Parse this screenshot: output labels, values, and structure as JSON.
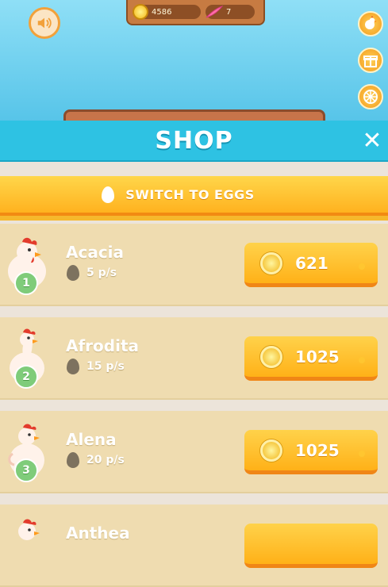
{
  "hud": {
    "coins": "4586",
    "feathers": "7"
  },
  "header": {
    "title": "SHOP"
  },
  "switch": {
    "label": "SWITCH TO EGGS"
  },
  "items": [
    {
      "level": "1",
      "name": "Acacia",
      "rate": "5 p/s",
      "price": "621"
    },
    {
      "level": "2",
      "name": "Afrodita",
      "rate": "15 p/s",
      "price": "1025"
    },
    {
      "level": "3",
      "name": "Alena",
      "rate": "20 p/s",
      "price": "1025"
    },
    {
      "level": "",
      "name": "Anthea",
      "rate": "",
      "price": ""
    }
  ],
  "icons": {
    "sound": "speaker-icon",
    "side": [
      "chicken-icon",
      "gift-icon",
      "wheel-icon"
    ],
    "close": "close-icon"
  },
  "colors": {
    "header": "#2ec2e3",
    "accent": "#ffb21f",
    "row": "#efdcb0",
    "level_badge": "#7fcc7a"
  }
}
